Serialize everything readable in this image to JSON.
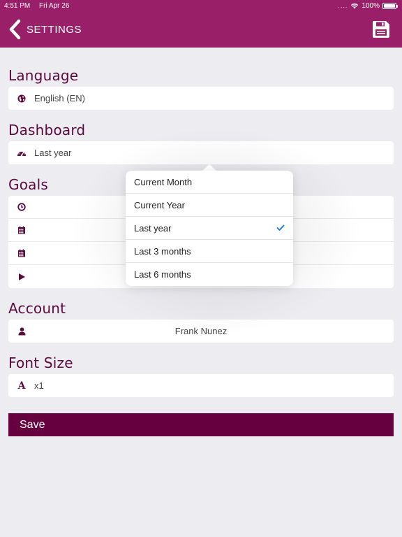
{
  "status_bar": {
    "time": "4:51 PM",
    "date": "Fri Apr 26",
    "battery": "100%"
  },
  "navbar": {
    "title": "SETTINGS",
    "back_icon": "chevron-left-icon",
    "save_icon": "floppy-disk-icon"
  },
  "sections": {
    "language": {
      "title": "Language",
      "value": "English (EN)",
      "icon": "globe-icon"
    },
    "dashboard": {
      "title": "Dashboard",
      "value": "Last year",
      "icon": "speedometer-icon"
    },
    "goals": {
      "title": "Goals",
      "rows": [
        "clock-icon",
        "calendar-icon",
        "calendar-icon",
        "play-icon"
      ]
    },
    "account": {
      "title": "Account",
      "value": "Frank Nunez",
      "icon": "user-icon"
    },
    "font_size": {
      "title": "Font Size",
      "value": "x1",
      "icon": "font-icon"
    }
  },
  "save_button": {
    "label": "Save"
  },
  "dropdown": {
    "options": [
      {
        "label": "Current Month",
        "selected": false
      },
      {
        "label": "Current Year",
        "selected": false
      },
      {
        "label": "Last year",
        "selected": true
      },
      {
        "label": "Last 3 months",
        "selected": false
      },
      {
        "label": "Last 6 months",
        "selected": false
      }
    ],
    "check_color": "#1a73e8"
  },
  "colors": {
    "brand": "#9a1f69",
    "heading": "#5a0a3c",
    "save_bg": "#66003f"
  }
}
